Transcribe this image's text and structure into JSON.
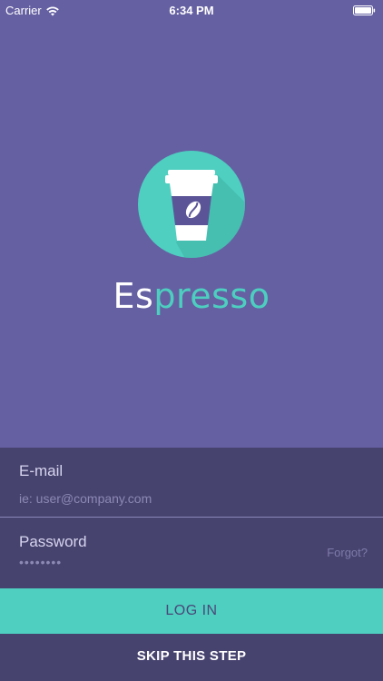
{
  "status_bar": {
    "carrier": "Carrier",
    "time": "6:34 PM",
    "icons": [
      "wifi-icon",
      "battery-icon"
    ]
  },
  "brand": {
    "name_part1": "Es",
    "name_part2": "presso",
    "logo_icon": "coffee-cup-icon",
    "colors": {
      "background": "#6560a2",
      "accent": "#4ecfc0",
      "panel": "#47436f"
    }
  },
  "form": {
    "email": {
      "label": "E-mail",
      "placeholder": "ie: user@company.com"
    },
    "password": {
      "label": "Password",
      "masked_value": "••••••••",
      "forgot_label": "Forgot?"
    }
  },
  "actions": {
    "login_label": "LOG IN",
    "skip_label": "SKIP THIS STEP"
  }
}
